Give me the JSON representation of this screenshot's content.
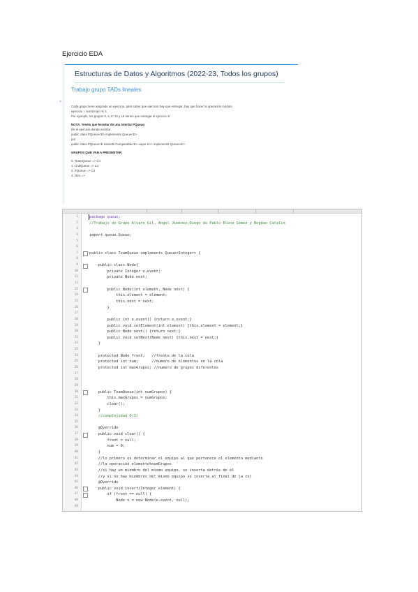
{
  "doc": {
    "title": "Ejercicio EDA"
  },
  "assignment": {
    "course_title": "Estructuras de Datos y Algoritmos (2022-23, Todos los grupos)",
    "task_title": "Trabajo grupo TADs lineales",
    "left_marker": "ar",
    "lines": [
      {
        "text": "Cada grupo tiene asignado un ejercicio, para saber que ejercicio hay que entregar, hay que hacer la operación módulo",
        "style": "normal"
      },
      {
        "text": "ejercicio = numGrupo % 4",
        "style": "normal"
      },
      {
        "text": "Por ejemplo, los grupos 0, 4, 8, 12 y 16 tienen que entregar el ejercicio 0",
        "style": "normal"
      },
      {
        "text": "",
        "style": "gap"
      },
      {
        "text": "NOTA: Tenéis que heredar de una interfaz PQueue:",
        "style": "bold"
      },
      {
        "text": "En el ejercicio donde escribe",
        "style": "normal"
      },
      {
        "text": "public class PQueue<E> implements Queue<E>",
        "style": "normal"
      },
      {
        "text": "por",
        "style": "normal"
      },
      {
        "text": "public class PQueue<E extends Comparable<E> super E>> implements Queue<E>",
        "style": "normal"
      },
      {
        "text": "",
        "style": "gap"
      },
      {
        "text": "GRUPOS QUE VAN A PRESENTAR:",
        "style": "bold"
      },
      {
        "text": "",
        "style": "gap"
      },
      {
        "text": "0. TeamQueue => C4",
        "style": "normal"
      },
      {
        "text": "1. LinkQueue => C1",
        "style": "normal"
      },
      {
        "text": "2. PQueue => C3",
        "style": "normal"
      },
      {
        "text": "3. Otro =>",
        "style": "normal"
      }
    ]
  },
  "editor": {
    "lines": [
      {
        "n": "1",
        "text": "package queue;",
        "fold": false,
        "style": "kw"
      },
      {
        "n": "2",
        "text": "//Trabajo de Grupo Alvaro Gil, Angel Jiménez,Diego de Pablo Elena Gómez y Bogdan Catalin",
        "fold": false,
        "style": "comment"
      },
      {
        "n": "3",
        "text": "",
        "fold": false,
        "style": "normal"
      },
      {
        "n": "4",
        "text": "import queue.Queue;",
        "fold": false,
        "style": "normal"
      },
      {
        "n": "5",
        "text": "",
        "fold": false,
        "style": "normal"
      },
      {
        "n": "6",
        "text": "",
        "fold": false,
        "style": "normal"
      },
      {
        "n": "7",
        "text": "public class TeamQueue implements Queue<Integer> {",
        "fold": true,
        "style": "normal"
      },
      {
        "n": "8",
        "text": "",
        "fold": false,
        "style": "normal"
      },
      {
        "n": "9",
        "text": "    public class Node{",
        "fold": true,
        "style": "normal"
      },
      {
        "n": "10",
        "text": "        private Integer e,event;",
        "fold": false,
        "style": "normal"
      },
      {
        "n": "11",
        "text": "        private Node next;",
        "fold": false,
        "style": "normal"
      },
      {
        "n": "12",
        "text": "",
        "fold": false,
        "style": "normal"
      },
      {
        "n": "13",
        "text": "        public Node(int element, Node next) {",
        "fold": true,
        "style": "normal"
      },
      {
        "n": "14",
        "text": "            this.element = element;",
        "fold": false,
        "style": "normal"
      },
      {
        "n": "15",
        "text": "            this.next = next;",
        "fold": false,
        "style": "normal"
      },
      {
        "n": "16",
        "text": "        }",
        "fold": false,
        "style": "normal"
      },
      {
        "n": "17",
        "text": "",
        "fold": false,
        "style": "normal"
      },
      {
        "n": "18",
        "text": "        public int e.event() {return e.event;}",
        "fold": false,
        "style": "normal"
      },
      {
        "n": "19",
        "text": "        public void setElement(int element) {this.element = element;}",
        "fold": false,
        "style": "normal"
      },
      {
        "n": "20",
        "text": "        public Node next() {return next;}",
        "fold": false,
        "style": "normal"
      },
      {
        "n": "21",
        "text": "        public void setNext(Node next) {this.next = next;}",
        "fold": false,
        "style": "normal"
      },
      {
        "n": "22",
        "text": "    }",
        "fold": false,
        "style": "normal"
      },
      {
        "n": "23",
        "text": "",
        "fold": false,
        "style": "normal"
      },
      {
        "n": "24",
        "text": "    protected Node front;   //frente de la cola",
        "fold": false,
        "style": "normal"
      },
      {
        "n": "25",
        "text": "    protected int num;      //numero de elementos en la cola",
        "fold": false,
        "style": "normal"
      },
      {
        "n": "26",
        "text": "    protected int maxGrupos; //numero de grupos diferentes",
        "fold": false,
        "style": "normal"
      },
      {
        "n": "27",
        "text": "",
        "fold": false,
        "style": "normal"
      },
      {
        "n": "28",
        "text": "",
        "fold": false,
        "style": "normal"
      },
      {
        "n": "29",
        "text": "",
        "fold": false,
        "style": "normal"
      },
      {
        "n": "30",
        "text": "    public TeamQueue(int numGrupos) {",
        "fold": true,
        "style": "normal"
      },
      {
        "n": "31",
        "text": "        this.maxGrupos = numGrupos;",
        "fold": false,
        "style": "normal"
      },
      {
        "n": "32",
        "text": "        clear();",
        "fold": false,
        "style": "normal"
      },
      {
        "n": "33",
        "text": "    }",
        "fold": false,
        "style": "normal"
      },
      {
        "n": "34",
        "text": "    //complejidad O(1)",
        "fold": false,
        "style": "comment"
      },
      {
        "n": "35",
        "text": "",
        "fold": false,
        "style": "normal"
      },
      {
        "n": "36",
        "text": "    @Override",
        "fold": false,
        "style": "normal"
      },
      {
        "n": "37",
        "text": "    public void clear() {",
        "fold": true,
        "style": "normal"
      },
      {
        "n": "38",
        "text": "        front = null;",
        "fold": false,
        "style": "normal"
      },
      {
        "n": "39",
        "text": "        num = 0;",
        "fold": false,
        "style": "normal"
      },
      {
        "n": "40",
        "text": "    }",
        "fold": false,
        "style": "normal"
      },
      {
        "n": "41",
        "text": "    //lo primero es determinar el equipo al que pertenece el elemento mediante",
        "fold": false,
        "style": "normal"
      },
      {
        "n": "42",
        "text": "    //la operación elemento%numGrupos",
        "fold": false,
        "style": "normal"
      },
      {
        "n": "43",
        "text": "    //si hay un miembro del mismo equipo, se inserta detrás de él",
        "fold": false,
        "style": "normal"
      },
      {
        "n": "44",
        "text": "    //y si no hay miembros del mismo equipo se inserta al final de la col",
        "fold": false,
        "style": "normal"
      },
      {
        "n": "45",
        "text": "    @Override",
        "fold": false,
        "style": "normal"
      },
      {
        "n": "46",
        "text": "    public void insert(Integer element) {",
        "fold": true,
        "style": "normal"
      },
      {
        "n": "47",
        "text": "        if (front == null) {",
        "fold": true,
        "style": "normal"
      },
      {
        "n": "48",
        "text": "            Node n = new Node(e.event, null);",
        "fold": false,
        "style": "normal"
      },
      {
        "n": "49",
        "text": "",
        "fold": false,
        "style": "normal"
      }
    ]
  }
}
